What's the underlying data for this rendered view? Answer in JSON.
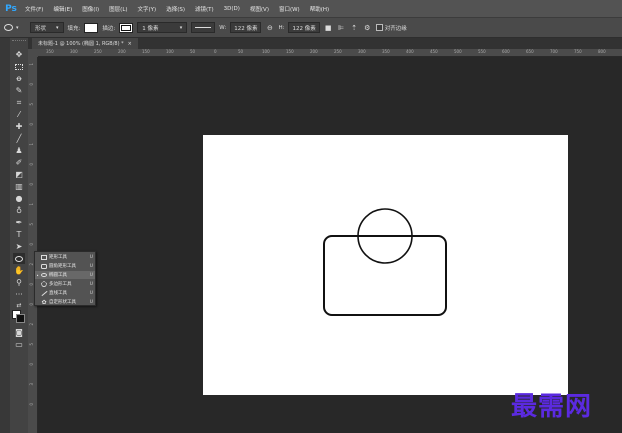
{
  "app": {
    "logo": "Ps"
  },
  "menu": [
    "文件(F)",
    "编辑(E)",
    "图像(I)",
    "图层(L)",
    "文字(Y)",
    "选择(S)",
    "滤镜(T)",
    "3D(D)",
    "视图(V)",
    "窗口(W)",
    "帮助(H)"
  ],
  "options": {
    "mode": "形状",
    "fill_label": "填充:",
    "stroke_label": "描边:",
    "stroke_width": "1 像素",
    "w_label": "W:",
    "w_value": "122 像素",
    "link_icon": "link-icon",
    "h_label": "H:",
    "h_value": "122 像素",
    "align_edges": "对齐边缘"
  },
  "document_tab": {
    "title": "未标题-1 @ 100% (椭圆 1, RGB/8) *",
    "close": "×"
  },
  "ruler": {
    "h_labels": [
      "350",
      "300",
      "250",
      "200",
      "150",
      "100",
      "50",
      "0",
      "50",
      "100",
      "150",
      "200",
      "250",
      "300",
      "350",
      "400",
      "450",
      "500",
      "550",
      "600",
      "650",
      "700",
      "750",
      "800"
    ],
    "v_labels": [
      "1",
      "0",
      "5",
      "0",
      "1",
      "0",
      "0",
      "1",
      "5",
      "0",
      "2",
      "0",
      "0",
      "2",
      "5",
      "0",
      "3",
      "0"
    ]
  },
  "toolbar": {
    "tools": [
      "move-tool-icon",
      "marquee-tool-icon",
      "lasso-tool-icon",
      "quick-select-tool-icon",
      "crop-tool-icon",
      "eyedropper-tool-icon",
      "healing-brush-tool-icon",
      "brush-tool-icon",
      "clone-stamp-tool-icon",
      "history-brush-tool-icon",
      "eraser-tool-icon",
      "gradient-tool-icon",
      "blur-tool-icon",
      "dodge-tool-icon",
      "pen-tool-icon",
      "type-tool-icon",
      "path-select-tool-icon",
      "ellipse-tool-icon",
      "hand-tool-icon",
      "zoom-tool-icon",
      "more-tools-icon"
    ],
    "type_glyph": "T",
    "more_glyph": "···"
  },
  "shape_flyout": {
    "items": [
      {
        "label": "矩形工具",
        "key": "U",
        "icon": "rectangle-icon",
        "selected": false
      },
      {
        "label": "圆角矩形工具",
        "key": "U",
        "icon": "rounded-rectangle-icon",
        "selected": false
      },
      {
        "label": "椭圆工具",
        "key": "U",
        "icon": "ellipse-icon",
        "selected": true
      },
      {
        "label": "多边形工具",
        "key": "U",
        "icon": "polygon-icon",
        "selected": false
      },
      {
        "label": "直线工具",
        "key": "U",
        "icon": "line-icon",
        "selected": false
      },
      {
        "label": "自定形状工具",
        "key": "U",
        "icon": "custom-shape-icon",
        "selected": false
      }
    ],
    "bullet": "•"
  },
  "colors": {
    "foreground": "#ffffff",
    "background": "#111111",
    "canvas": "#ffffff",
    "workspace": "#282828"
  },
  "watermark": "最需网"
}
